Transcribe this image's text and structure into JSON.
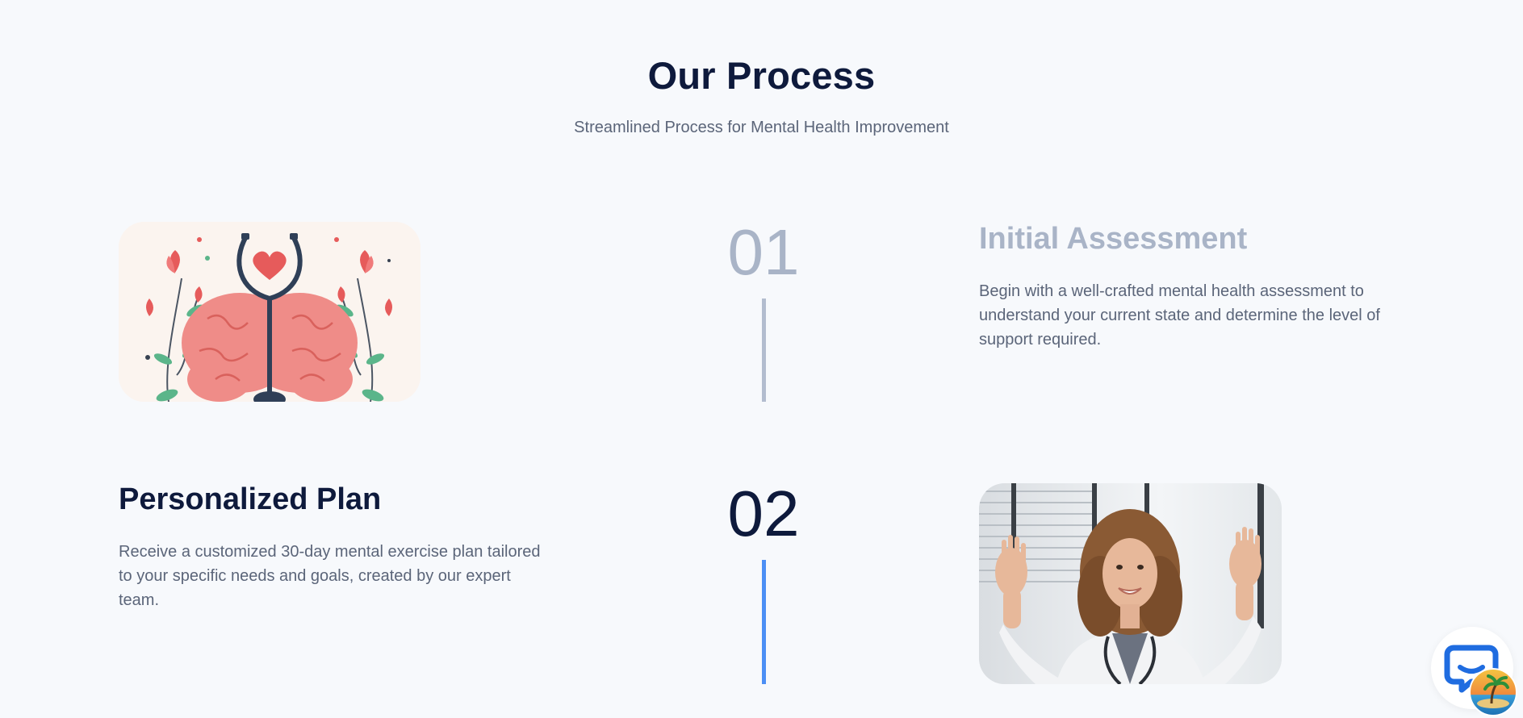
{
  "section": {
    "title": "Our Process",
    "subtitle": "Streamlined Process for Mental Health Improvement"
  },
  "steps": [
    {
      "number": "01",
      "title": "Initial Assessment",
      "description": "Begin with a well-crafted mental health assessment to understand your current state and determine the level of support required.",
      "image": "brain-stethoscope-illustration"
    },
    {
      "number": "02",
      "title": "Personalized Plan",
      "description": "Receive a customized 30-day mental exercise plan tailored to your specific needs and goals, created by our expert team.",
      "image": "doctor-video-call-photo"
    }
  ],
  "colors": {
    "heading": "#0e1a3c",
    "muted": "#a9b4c7",
    "text": "#5b6579",
    "accent": "#4c8ff5"
  },
  "widgets": {
    "chat_icon": "chat-icon",
    "badge_icon": "island-badge-icon"
  }
}
